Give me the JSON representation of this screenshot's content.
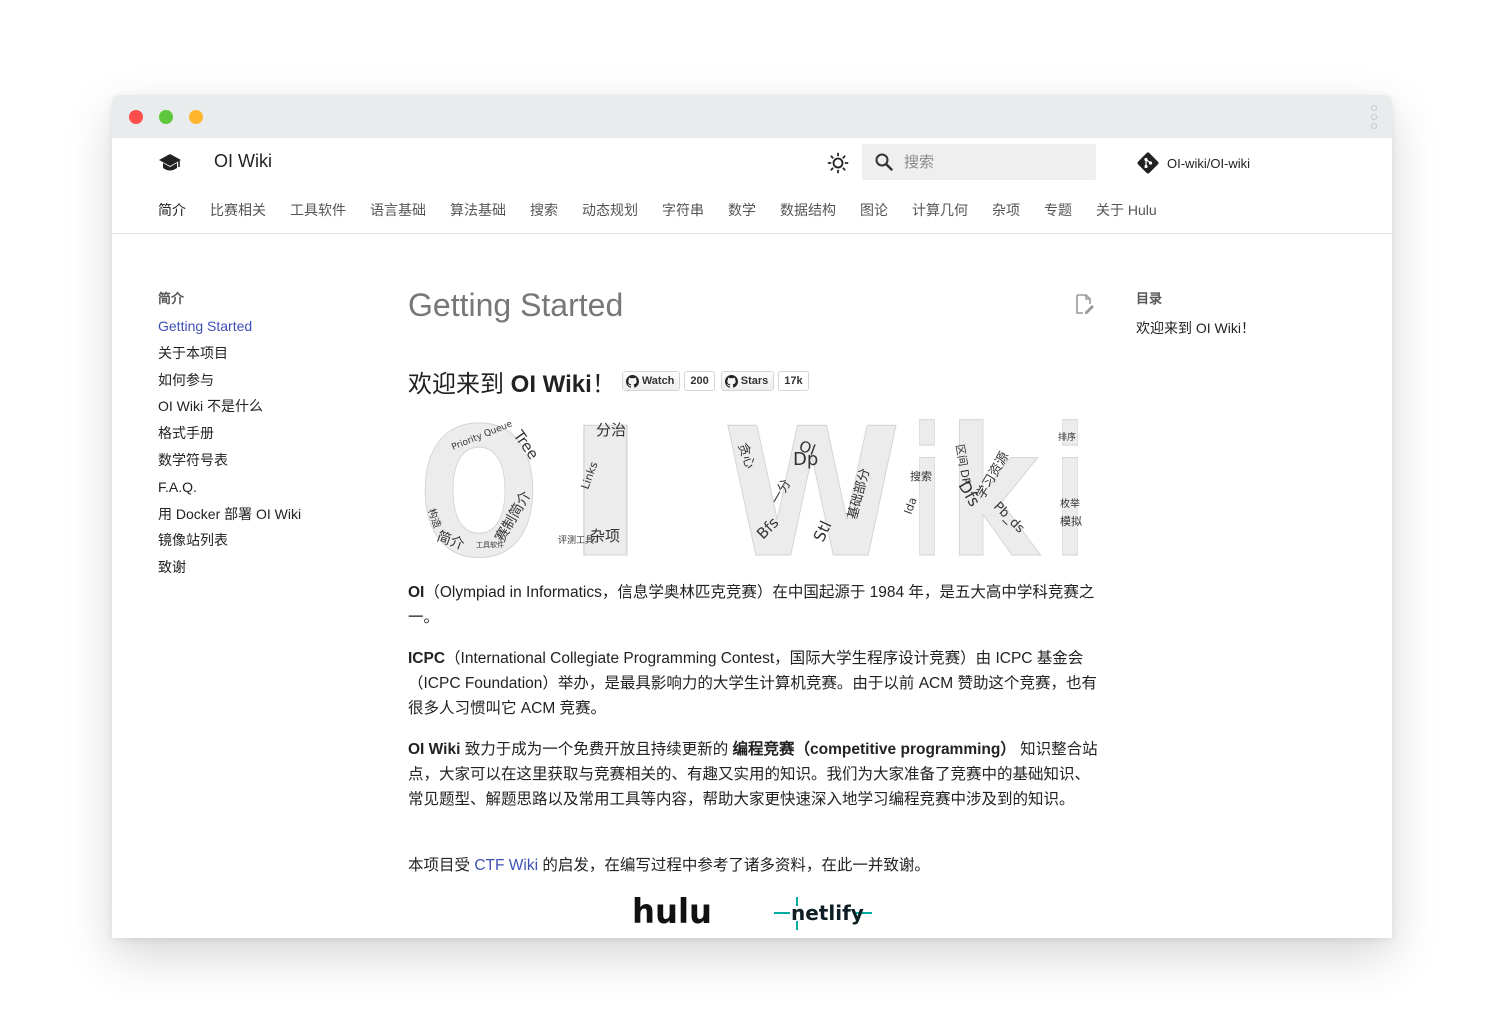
{
  "header": {
    "site_title": "OI Wiki",
    "search_placeholder": "搜索",
    "repo": "OI-wiki/OI-wiki"
  },
  "tabs": [
    "简介",
    "比赛相关",
    "工具软件",
    "语言基础",
    "算法基础",
    "搜索",
    "动态规划",
    "字符串",
    "数学",
    "数据结构",
    "图论",
    "计算几何",
    "杂项",
    "专题",
    "关于 Hulu"
  ],
  "nav": {
    "title": "简介",
    "items": [
      "Getting Started",
      "关于本项目",
      "如何参与",
      "OI Wiki 不是什么",
      "格式手册",
      "数学符号表",
      "F.A.Q.",
      "用 Docker 部署 OI Wiki",
      "镜像站列表",
      "致谢"
    ]
  },
  "toc": {
    "title": "目录",
    "items": [
      "欢迎来到 OI Wiki！"
    ]
  },
  "main": {
    "title": "Getting Started",
    "welcome_prefix": "欢迎来到 ",
    "welcome_bold": "OI Wiki",
    "welcome_suffix": "！",
    "badges": {
      "watch_label": "Watch",
      "watch_count": "200",
      "stars_label": "Stars",
      "stars_count": "17k"
    },
    "wordcloud": {
      "big_letters": [
        "O",
        "I",
        "W",
        "i",
        "k",
        "i"
      ],
      "words": [
        "Priority Queue",
        "Tree",
        "简介",
        "赛制简介",
        "Links",
        "分治",
        "杂项",
        "评测工具",
        "Bfs",
        "Dp",
        "OI",
        "贪心",
        "一分",
        "Stl",
        "基础部分",
        "搜索",
        "Ida",
        "区间 DP",
        "Dfs",
        "学习资源",
        "Pb_ds",
        "排序",
        "模拟",
        "枚举",
        "构造",
        "工具软件"
      ]
    },
    "para1_bold": "OI",
    "para1": "（Olympiad in Informatics，信息学奥林匹克竞赛）在中国起源于 1984 年，是五大高中学科竞赛之一。",
    "para2_bold": "ICPC",
    "para2": "（International Collegiate Programming Contest，国际大学生程序设计竞赛）由 ICPC 基金会（ICPC Foundation）举办，是最具影响力的大学生计算机竞赛。由于以前 ACM 赞助这个竞赛，也有很多人习惯叫它 ACM 竞赛。",
    "para3_bold1": "OI Wiki",
    "para3_mid": " 致力于成为一个免费开放且持续更新的 ",
    "para3_bold2": "编程竞赛（competitive programming）",
    "para3_end": " 知识整合站点，大家可以在这里获取与竞赛相关的、有趣又实用的知识。我们为大家准备了竞赛中的基础知识、常见题型、解题思路以及常用工具等内容，帮助大家更快速深入地学习编程竞赛中涉及到的知识。",
    "para4_start": "本项目受 ",
    "para4_link": "CTF Wiki",
    "para4_end": " 的启发，在编写过程中参考了诸多资料，在此一并致谢。",
    "sponsors": [
      "hulu",
      "netlify"
    ]
  },
  "colors": {
    "link": "#3f51b5",
    "titlebar": "#e8ecec",
    "traffic_red": "#fe4d4c",
    "traffic_green": "#5ec73b",
    "traffic_yellow": "#ffb52b",
    "netlify": "#00ad9f"
  },
  "icons": {
    "logo": "graduation-cap-icon",
    "theme": "brightness-icon",
    "search": "search-icon",
    "repo": "git-icon",
    "edit": "edit-page-icon"
  }
}
